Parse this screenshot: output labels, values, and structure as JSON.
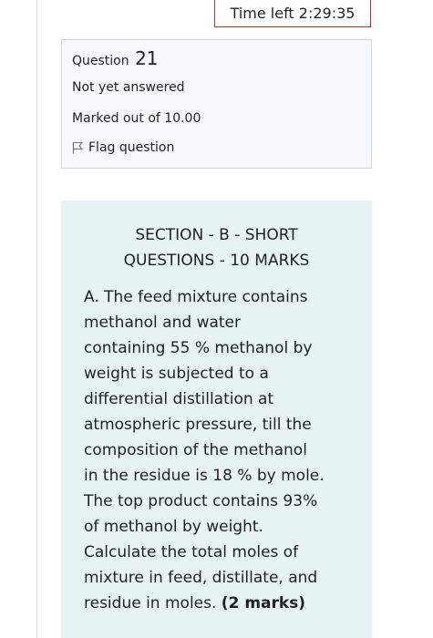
{
  "timer": {
    "label": "Time left 2:29:35"
  },
  "question_info": {
    "prefix": "Question",
    "number": "21",
    "state": "Not yet answered",
    "grade": "Marked out of 10.00",
    "flag_label": "Flag question",
    "flag_icon": "flag-icon"
  },
  "question_text": {
    "heading_lines": [
      "SECTION - B - SHORT",
      "QUESTIONS - 10 MARKS"
    ],
    "body_lines": [
      "A. The feed mixture contains",
      "methanol and water",
      "containing 55 % methanol by",
      "weight is subjected to a",
      "differential distillation at",
      "atmospheric pressure, till the",
      "composition of the methanol",
      "in the residue is 18 % by mole.",
      "The top product contains 93%",
      "of methanol by weight.",
      "Calculate the total moles of",
      "mixture in feed, distillate, and",
      "residue in moles."
    ],
    "marks": "(2 marks)"
  },
  "colors": {
    "timer_border": "#ca3120",
    "info_background": "#f8f9fa",
    "question_background": "#e7f3f5",
    "text": "#1d2125"
  }
}
